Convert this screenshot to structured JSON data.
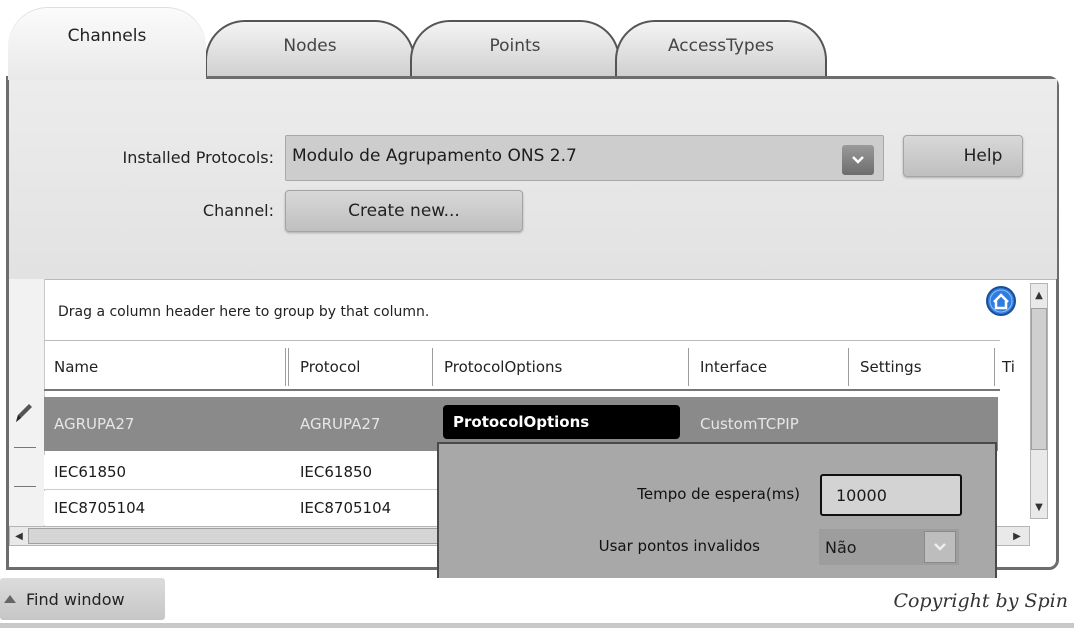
{
  "tabs": [
    {
      "label": "Channels",
      "active": true
    },
    {
      "label": "Nodes",
      "active": false
    },
    {
      "label": "Points",
      "active": false
    },
    {
      "label": "AccessTypes",
      "active": false
    }
  ],
  "form": {
    "installed_protocols_label": "Installed Protocols:",
    "installed_protocols_value": "Modulo de Agrupamento ONS 2.7",
    "help_label": "Help",
    "channel_label": "Channel:",
    "create_new_label": "Create new..."
  },
  "grid": {
    "group_hint": "Drag a column header here to group by that column.",
    "columns": [
      "Name",
      "Protocol",
      "ProtocolOptions",
      "Interface",
      "Settings",
      "Tir"
    ],
    "rows": [
      {
        "name": "AGRUPA27",
        "protocol": "AGRUPA27",
        "protocol_options": "ProtocolOptions",
        "interface": "CustomTCPIP",
        "settings": ""
      },
      {
        "name": "IEC61850",
        "protocol": "IEC61850",
        "protocol_options": "",
        "interface": "",
        "settings": ""
      },
      {
        "name": "IEC8705104",
        "protocol": "IEC8705104",
        "protocol_options": "",
        "interface": "",
        "settings": ""
      }
    ]
  },
  "popup": {
    "timeout_label": "Tempo de espera(ms)",
    "timeout_value": "10000",
    "invalid_points_label": "Usar pontos invalidos",
    "invalid_points_value": "Não"
  },
  "footer": {
    "find_window_label": "Find window",
    "copyright": "Copyright by Spin"
  },
  "colors": {
    "selected_row": "#8a8a8a",
    "accent_blue": "#2f7de0"
  },
  "icons": [
    "chevron-down-icon",
    "home-icon",
    "pencil-icon",
    "scroll-up-icon",
    "scroll-down-icon",
    "scroll-left-icon",
    "scroll-right-icon"
  ]
}
